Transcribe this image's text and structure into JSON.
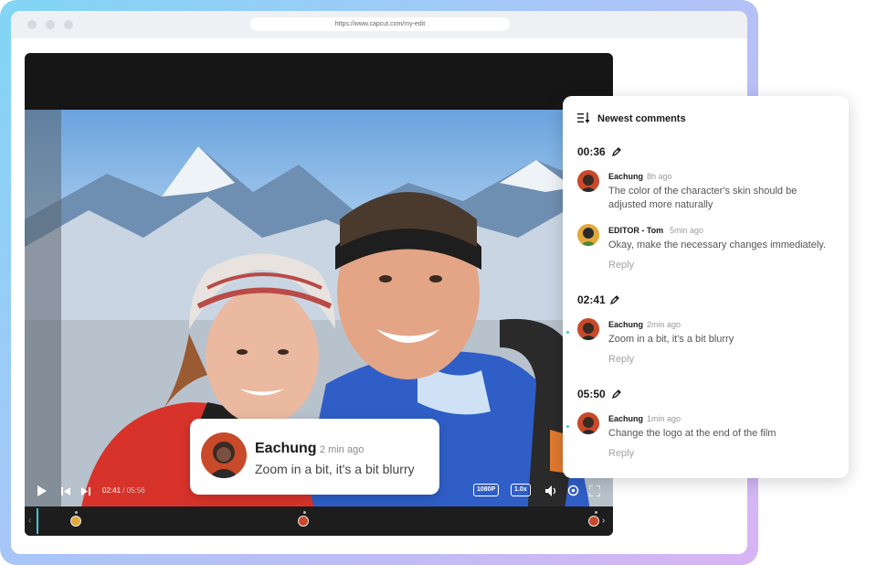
{
  "browser": {
    "url": "https://www.capcut.com/my-edit"
  },
  "player": {
    "current_time": "02:41",
    "separator": "/",
    "duration": "05:56",
    "quality": "1080P",
    "speed": "1.0x",
    "icons": [
      "play-icon",
      "prev-icon",
      "next-icon",
      "volume-icon",
      "settings-icon",
      "fullscreen-icon"
    ]
  },
  "bubble": {
    "name": "Eachung",
    "time": "2 min ago",
    "text": "Zoom in a bit, it's a bit blurry"
  },
  "panel": {
    "title": "Newest comments",
    "groups": [
      {
        "timestamp": "00:36",
        "comments": [
          {
            "name": "Eachung",
            "time": "8h ago",
            "text": "The color of the character's skin should be adjusted more naturally"
          },
          {
            "name": "EDITOR - Tom",
            "time": "5min ago",
            "text": "Okay, make the necessary changes immediately.",
            "reply": "Reply"
          }
        ]
      },
      {
        "timestamp": "02:41",
        "comments": [
          {
            "name": "Eachung",
            "time": "2min ago",
            "text": "Zoom in a bit, it's a bit blurry",
            "reply": "Reply"
          }
        ]
      },
      {
        "timestamp": "05:50",
        "comments": [
          {
            "name": "Eachung",
            "time": "1min ago",
            "text": "Change the logo at the end of the film",
            "reply": "Reply"
          }
        ]
      }
    ]
  },
  "colors": {
    "accent": "#42c3d8",
    "frame_start": "#82d6f5",
    "frame_end": "#d9b4f4",
    "marker": "#c84a2a"
  }
}
